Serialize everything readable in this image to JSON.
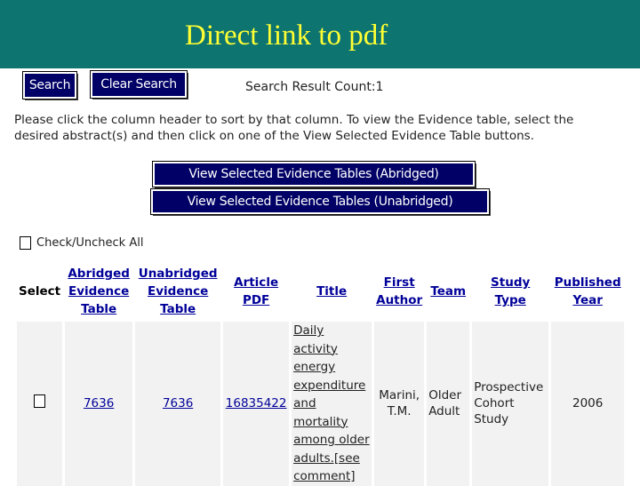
{
  "banner": {
    "title": "Direct link to pdf"
  },
  "toolbar": {
    "search_label": "Search",
    "clear_label": "Clear Search",
    "result_count": "Search Result Count:1"
  },
  "instructions": "Please click the column header to sort by that column. To view the Evidence table, select the desired abstract(s) and then click on one of the View Selected Evidence Table buttons.",
  "actions": {
    "view_abridged": "View Selected Evidence Tables (Abridged)",
    "view_unabridged": "View Selected Evidence Tables (Unabridged)"
  },
  "check_all": {
    "label": "Check/Uncheck All"
  },
  "table": {
    "headers": {
      "select": "Select",
      "abridged": "Abridged Evidence Table",
      "unabridged": "Unabridged Evidence Table",
      "article": "Article PDF",
      "title": "Title",
      "first_author": "First Author",
      "team": "Team",
      "study_type": "Study Type",
      "published_year": "Published Year"
    },
    "rows": [
      {
        "abridged": "7636",
        "unabridged": "7636",
        "article": "16835422",
        "title": "Daily activity energy expenditure and mortality among older adults.[see comment]",
        "first_author": "Marini, T.M.",
        "team": "Older Adult",
        "study_type": "Prospective Cohort Study",
        "published_year": "2006"
      }
    ]
  },
  "colors": {
    "banner": "#0e7470",
    "banner_text": "#ffff33",
    "button": "#000066",
    "link": "#000099"
  }
}
